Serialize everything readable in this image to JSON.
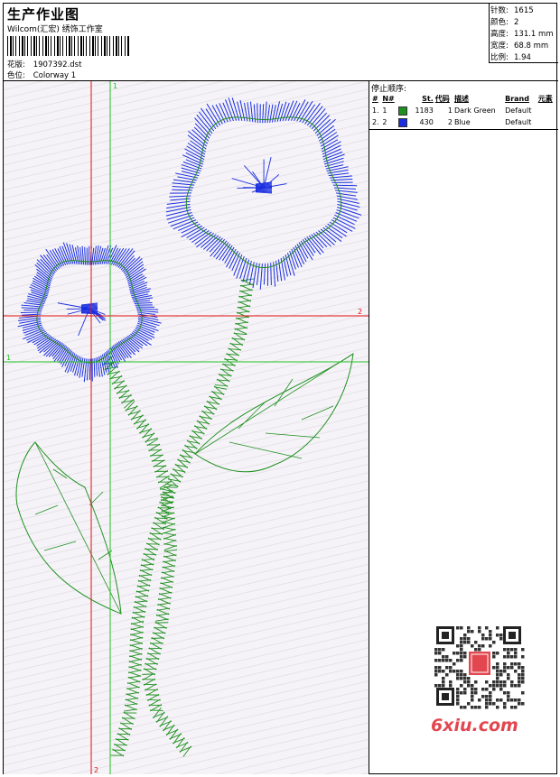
{
  "header": {
    "title": "生产作业图",
    "subtitle": "Wilcom(汇宏) 绣饰工作室",
    "design_label": "花版:",
    "design_value": "1907392.dst",
    "color_label": "色位:",
    "color_value": "Colorway 1"
  },
  "stats": {
    "stitches_label": "针数:",
    "stitches": "1615",
    "colors_label": "颜色:",
    "colors": "2",
    "height_label": "高度:",
    "height": "131.1 mm",
    "width_label": "宽度:",
    "width": "68.8 mm",
    "scale_label": "比例:",
    "scale": "1.94"
  },
  "stop_sequence": {
    "title": "停止顺序:",
    "headers": [
      "#",
      "N#",
      "St.",
      "代码",
      "描述",
      "Brand",
      "元素"
    ],
    "rows": [
      {
        "idx": "1.",
        "n": "1",
        "color": "#1f8f1f",
        "st": "1183",
        "code": "1",
        "desc": "Dark Green",
        "brand": "Default"
      },
      {
        "idx": "2.",
        "n": "2",
        "color": "#1a2ee0",
        "st": "430",
        "code": "2",
        "desc": "Blue",
        "brand": "Default"
      }
    ]
  },
  "guides": {
    "v1_label": "1",
    "v2_label": "2",
    "h1_label": "1",
    "h2_label": "2",
    "green": "#22c322",
    "red": "#e01010"
  },
  "thread_colors": {
    "green": "#1f8f1f",
    "blue": "#1a2ee0"
  },
  "watermark": {
    "text": "6xiu.com",
    "color": "#e2474f"
  }
}
